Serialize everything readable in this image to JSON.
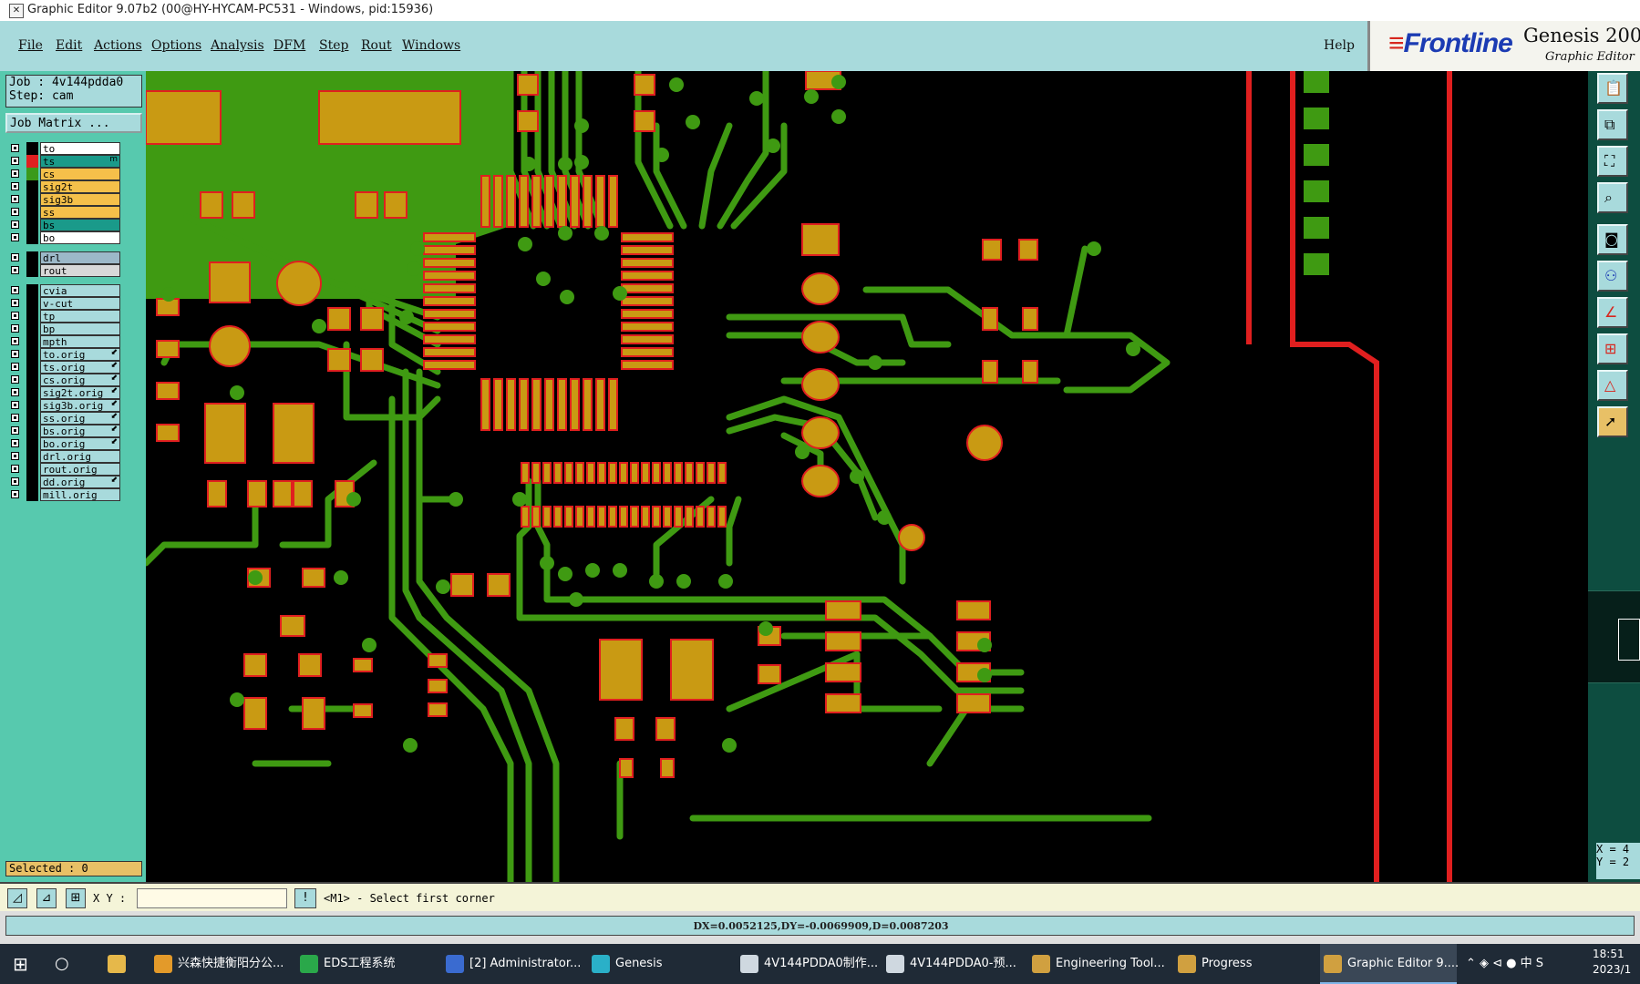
{
  "title_bar": {
    "text": "Graphic Editor 9.07b2 (00@HY-HYCAM-PC531 - Windows, pid:15936)"
  },
  "menu": {
    "items": [
      {
        "label": "File"
      },
      {
        "label": "Edit"
      },
      {
        "label": "Actions"
      },
      {
        "label": "Options"
      },
      {
        "label": "Analysis"
      },
      {
        "label": "DFM"
      },
      {
        "label": "Step"
      },
      {
        "label": "Rout"
      },
      {
        "label": "Windows"
      }
    ],
    "help": "Help"
  },
  "logo": {
    "brand": "Frontline",
    "product": "Genesis 2000",
    "subtitle": "Graphic Editor"
  },
  "job": {
    "job_line": "Job : 4v144pdda0",
    "step_line": "Step: cam",
    "matrix_button": "Job Matrix ..."
  },
  "layers": [
    {
      "name": "to",
      "color": "#ffffff",
      "swatch": "#000000"
    },
    {
      "name": "ts",
      "color": "#1a9a8a",
      "swatch": "#e02020",
      "tag": "m"
    },
    {
      "name": "cs",
      "color": "#f5c04a",
      "swatch": "#3a9a1a"
    },
    {
      "name": "sig2t",
      "color": "#f5c04a",
      "swatch": "#000000"
    },
    {
      "name": "sig3b",
      "color": "#f5c04a",
      "swatch": "#000000"
    },
    {
      "name": "ss",
      "color": "#f5c04a",
      "swatch": "#000000"
    },
    {
      "name": "bs",
      "color": "#1a9a8a",
      "swatch": "#000000"
    },
    {
      "name": "bo",
      "color": "#ffffff",
      "swatch": "#000000"
    },
    {
      "name": "drl",
      "color": "#9cb8c8",
      "swatch": "#000000"
    },
    {
      "name": "rout",
      "color": "#d8d8d8",
      "swatch": "#000000"
    },
    {
      "name": "cvia",
      "color": "#a8dadc",
      "swatch": "#000000"
    },
    {
      "name": "v-cut",
      "color": "#a8dadc",
      "swatch": "#000000"
    },
    {
      "name": "tp",
      "color": "#a8dadc",
      "swatch": "#000000"
    },
    {
      "name": "bp",
      "color": "#a8dadc",
      "swatch": "#000000"
    },
    {
      "name": "mpth",
      "color": "#a8dadc",
      "swatch": "#000000"
    },
    {
      "name": "to.orig",
      "color": "#a8dadc",
      "swatch": "#000000",
      "tag": "⬋"
    },
    {
      "name": "ts.orig",
      "color": "#a8dadc",
      "swatch": "#000000",
      "tag": "⬋"
    },
    {
      "name": "cs.orig",
      "color": "#a8dadc",
      "swatch": "#000000",
      "tag": "⬋"
    },
    {
      "name": "sig2t.orig",
      "color": "#a8dadc",
      "swatch": "#000000",
      "tag": "⬋"
    },
    {
      "name": "sig3b.orig",
      "color": "#a8dadc",
      "swatch": "#000000",
      "tag": "⬋"
    },
    {
      "name": "ss.orig",
      "color": "#a8dadc",
      "swatch": "#000000",
      "tag": "⬋"
    },
    {
      "name": "bs.orig",
      "color": "#a8dadc",
      "swatch": "#000000",
      "tag": "⬋"
    },
    {
      "name": "bo.orig",
      "color": "#a8dadc",
      "swatch": "#000000",
      "tag": "⬋"
    },
    {
      "name": "drl.orig",
      "color": "#a8dadc",
      "swatch": "#000000"
    },
    {
      "name": "rout.orig",
      "color": "#a8dadc",
      "swatch": "#000000"
    },
    {
      "name": "dd.orig",
      "color": "#a8dadc",
      "swatch": "#000000",
      "tag": "⬋"
    },
    {
      "name": "mill.orig",
      "color": "#a8dadc",
      "swatch": "#000000"
    }
  ],
  "selected": "Selected : 0",
  "command": {
    "xy_label": "X Y :",
    "xy_value": "",
    "prompt": "<M1> - Select first corner"
  },
  "status": "DX=0.0052125,DY=-0.0069909,D=0.0087203",
  "coord_readout": {
    "x": "X = 4",
    "y": "Y = 2"
  },
  "colors": {
    "pad": "#c99a13",
    "trace": "#3f9a12",
    "outline": "#e01f1f",
    "background": "#000000"
  },
  "toolbar_icons": [
    "clipboard-icon",
    "layer-icon",
    "fit-icon",
    "zoom-icon",
    "snapshot-icon",
    "net-icon",
    "measure-icon",
    "components-icon",
    "warning-icon",
    "select-arrow-icon"
  ],
  "taskbar": [
    {
      "label": "兴森快捷衡阳分公...",
      "color": "#e39a2a"
    },
    {
      "label": "EDS工程系统",
      "color": "#2aa84a"
    },
    {
      "label": "[2] Administrator...",
      "color": "#3a6bd0"
    },
    {
      "label": "Genesis",
      "color": "#2ab0c8"
    },
    {
      "label": "4V144PDDA0制作...",
      "color": "#cfd8e0"
    },
    {
      "label": "4V144PDDA0-预...",
      "color": "#cfd8e0"
    },
    {
      "label": "Engineering Tool...",
      "color": "#d0a040"
    },
    {
      "label": "Progress",
      "color": "#d0a040"
    },
    {
      "label": "Graphic Editor 9....",
      "color": "#d0a040",
      "active": true
    }
  ],
  "clock": {
    "time": "18:51",
    "date": "2023/1"
  }
}
